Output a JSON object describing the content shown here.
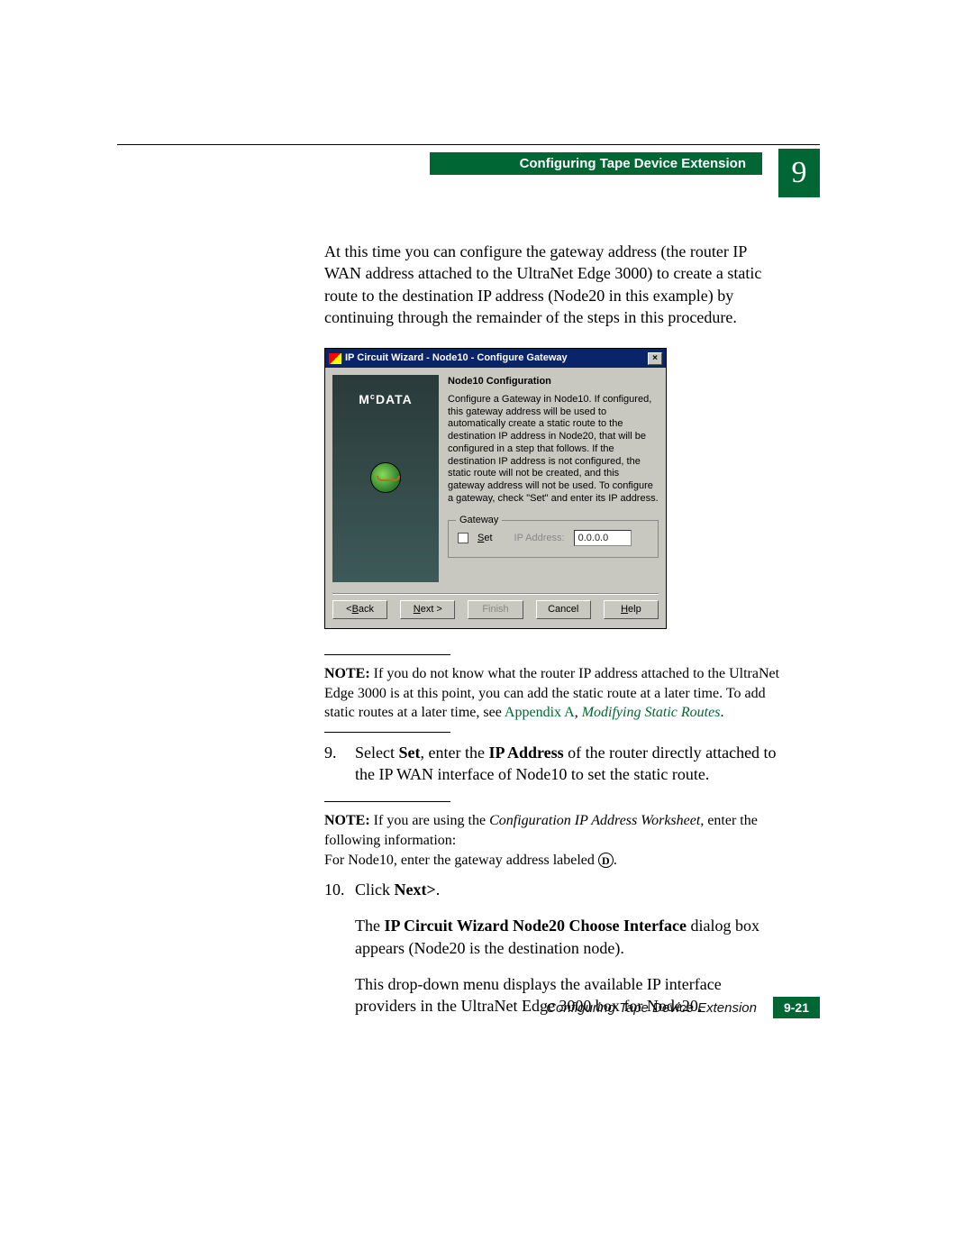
{
  "header": {
    "section_title": "Configuring Tape Device Extension",
    "chapter_number": "9"
  },
  "intro_para": "At this time you can configure the gateway address (the router IP WAN address attached to the UltraNet Edge 3000) to create a static route to the destination IP address (Node20 in this example) by continuing through the remainder of the steps in this procedure.",
  "dialog": {
    "title": "IP Circuit Wizard - Node10 - Configure Gateway",
    "logo": "McDATA",
    "heading": "Node10 Configuration",
    "body_text": "Configure a Gateway in Node10. If configured, this gateway address will be used to automatically create a static route to the destination IP address in Node20, that will be configured in a step that follows. If the destination IP address is not configured, the static route will not be created, and this gateway address will not be used. To configure a gateway, check \"Set\" and enter its IP address.",
    "group_legend": "Gateway",
    "set_label": "Set",
    "ip_label": "IP Address:",
    "ip_value": "0.0.0.0",
    "buttons": {
      "back": "< Back",
      "next": "Next >",
      "finish": "Finish",
      "cancel": "Cancel",
      "help": "Help"
    }
  },
  "note1": {
    "label": "NOTE:",
    "text_a": " If you do not know what the router IP address attached to the UltraNet Edge 3000 is at this point, you can add the static route at a later time. To add static routes at a later time, see ",
    "link_a": "Appendix A",
    "comma": ", ",
    "link_b": "Modifying Static Routes",
    "period": "."
  },
  "step9": {
    "num": "9.",
    "pre": "Select ",
    "b1": "Set",
    "mid1": ", enter the ",
    "b2": "IP Address",
    "mid2": " of the router directly attached to the IP WAN interface of Node10 to set the static route."
  },
  "note2": {
    "label": "NOTE:",
    "text_a": " If you are using the ",
    "ital": "Configuration IP Address Worksheet",
    "text_b": ", enter the following information:",
    "line2_a": "For Node10, enter the gateway address labeled ",
    "circled": "D",
    "line2_b": "."
  },
  "step10": {
    "num": "10.",
    "pre": "Click ",
    "b1": "Next>",
    "post": ".",
    "p2_a": "The ",
    "p2_b": "IP Circuit Wizard Node20 Choose Interface",
    "p2_c": " dialog box appears (Node20 is the destination node).",
    "p3": "This drop-down menu displays the available IP interface providers in the UltraNet Edge 3000 box for Node20."
  },
  "footer": {
    "text": "Configuring Tape Device Extension",
    "page": "9-21"
  }
}
